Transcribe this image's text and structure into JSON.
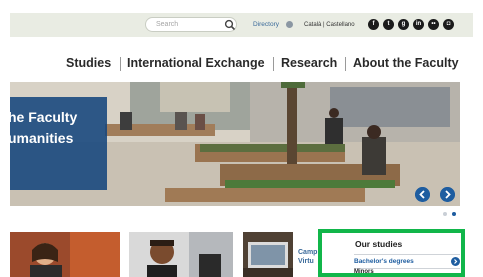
{
  "topbar": {
    "search_placeholder": "Search",
    "directory_label": "Directory",
    "languages": "Català | Castellano",
    "social_icons": [
      "facebook-icon",
      "twitter-icon",
      "googleplus-icon",
      "linkedin-icon",
      "flickr-icon",
      "instagram-icon"
    ]
  },
  "nav": {
    "items": [
      "Studies",
      "International Exchange",
      "Research",
      "About the Faculty"
    ]
  },
  "hero": {
    "caption_line1": "he Faculty",
    "caption_line2": "umanities",
    "slides_total": 2,
    "active_slide": 2
  },
  "tiles": {
    "campus_line1": "Camp",
    "campus_line2": "Virtu"
  },
  "studies": {
    "title": "Our studies",
    "links": [
      "Bachelor's degrees",
      "Minors"
    ]
  },
  "colors": {
    "accent_blue": "#1e5da0",
    "highlight_green": "#11b64a",
    "topbar_bg": "#e9ece3"
  }
}
